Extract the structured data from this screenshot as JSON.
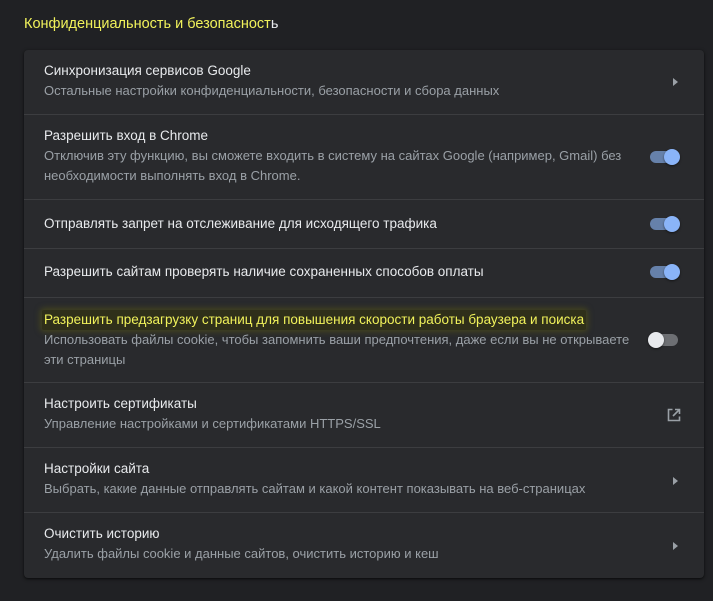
{
  "section": {
    "title_highlighted": "Конфиденциальность и безопасност",
    "title_rest": "ь"
  },
  "rows": [
    {
      "title": "Синхронизация сервисов Google",
      "subtitle": "Остальные настройки конфиденциальности, безопасности и сбора данных",
      "control": "arrow"
    },
    {
      "title": "Разрешить вход в Chrome",
      "subtitle": "Отключив эту функцию, вы сможете входить в систему на сайтах Google (например, Gmail) без необходимости выполнять вход в Chrome.",
      "control": "toggle",
      "enabled": true
    },
    {
      "title": "Отправлять запрет на отслеживание для исходящего трафика",
      "control": "toggle",
      "enabled": true
    },
    {
      "title": "Разрешить сайтам проверять наличие сохраненных способов оплаты",
      "control": "toggle",
      "enabled": true
    },
    {
      "title": "Разрешить предзагрузку страниц для повышения скорости работы браузера и поиска",
      "subtitle": "Использовать файлы cookie, чтобы запомнить ваши предпочтения, даже если вы не открываете эти страницы",
      "control": "toggle",
      "enabled": false,
      "highlighted": true
    },
    {
      "title": "Настроить сертификаты",
      "subtitle": "Управление настройками и сертификатами HTTPS/SSL",
      "control": "external-link-icon"
    },
    {
      "title": "Настройки сайта",
      "subtitle": "Выбрать, какие данные отправлять сайтам и какой контент показывать на веб-страницах",
      "control": "arrow"
    },
    {
      "title": "Очистить историю",
      "subtitle": "Удалить файлы cookie и данные сайтов, очистить историю и кеш",
      "control": "arrow"
    }
  ],
  "colors": {
    "page_background": "#202124",
    "card_background": "#292a2d",
    "divider": "#3c3d40",
    "primary_text": "#e8eaed",
    "secondary_text": "#9aa0a6",
    "highlight_text": "#f1f25b",
    "toggle_on": "#8ab4f8"
  }
}
